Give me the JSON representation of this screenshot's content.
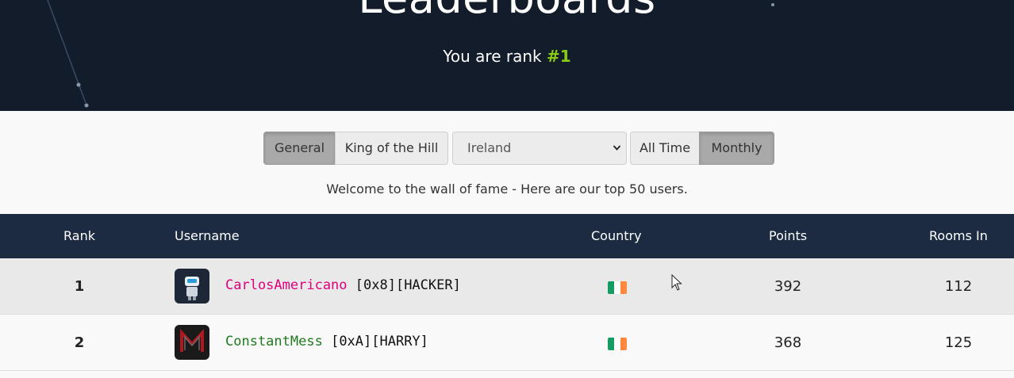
{
  "hero": {
    "title": "Leaderboards",
    "subtitle_prefix": "You are rank ",
    "subtitle_rank": "#1"
  },
  "controls": {
    "category_tabs": [
      {
        "label": "General",
        "active": true
      },
      {
        "label": "King of the Hill",
        "active": false
      }
    ],
    "country_select": {
      "value": "Ireland"
    },
    "period_tabs": [
      {
        "label": "All Time",
        "active": false
      },
      {
        "label": "Monthly",
        "active": true
      }
    ]
  },
  "welcome_text": "Welcome to the wall of fame - Here are our top 50 users.",
  "table": {
    "headers": {
      "rank": "Rank",
      "username": "Username",
      "country": "Country",
      "points": "Points",
      "rooms": "Rooms In"
    },
    "rows": [
      {
        "rank": "1",
        "username": "CarlosAmericano",
        "tags": "[0x8][HACKER]",
        "name_color": "#e0007a",
        "flag": "ireland-flag-icon",
        "points": "392",
        "rooms": "112"
      },
      {
        "rank": "2",
        "username": "ConstantMess",
        "tags": "[0xA][HARRY]",
        "name_color": "#1f7a1f",
        "flag": "ireland-flag-icon",
        "points": "368",
        "rooms": "125"
      }
    ]
  },
  "colors": {
    "hero_bg": "#131c2b",
    "header_bg": "#1c2a42",
    "rank_accent": "#88cc14"
  }
}
